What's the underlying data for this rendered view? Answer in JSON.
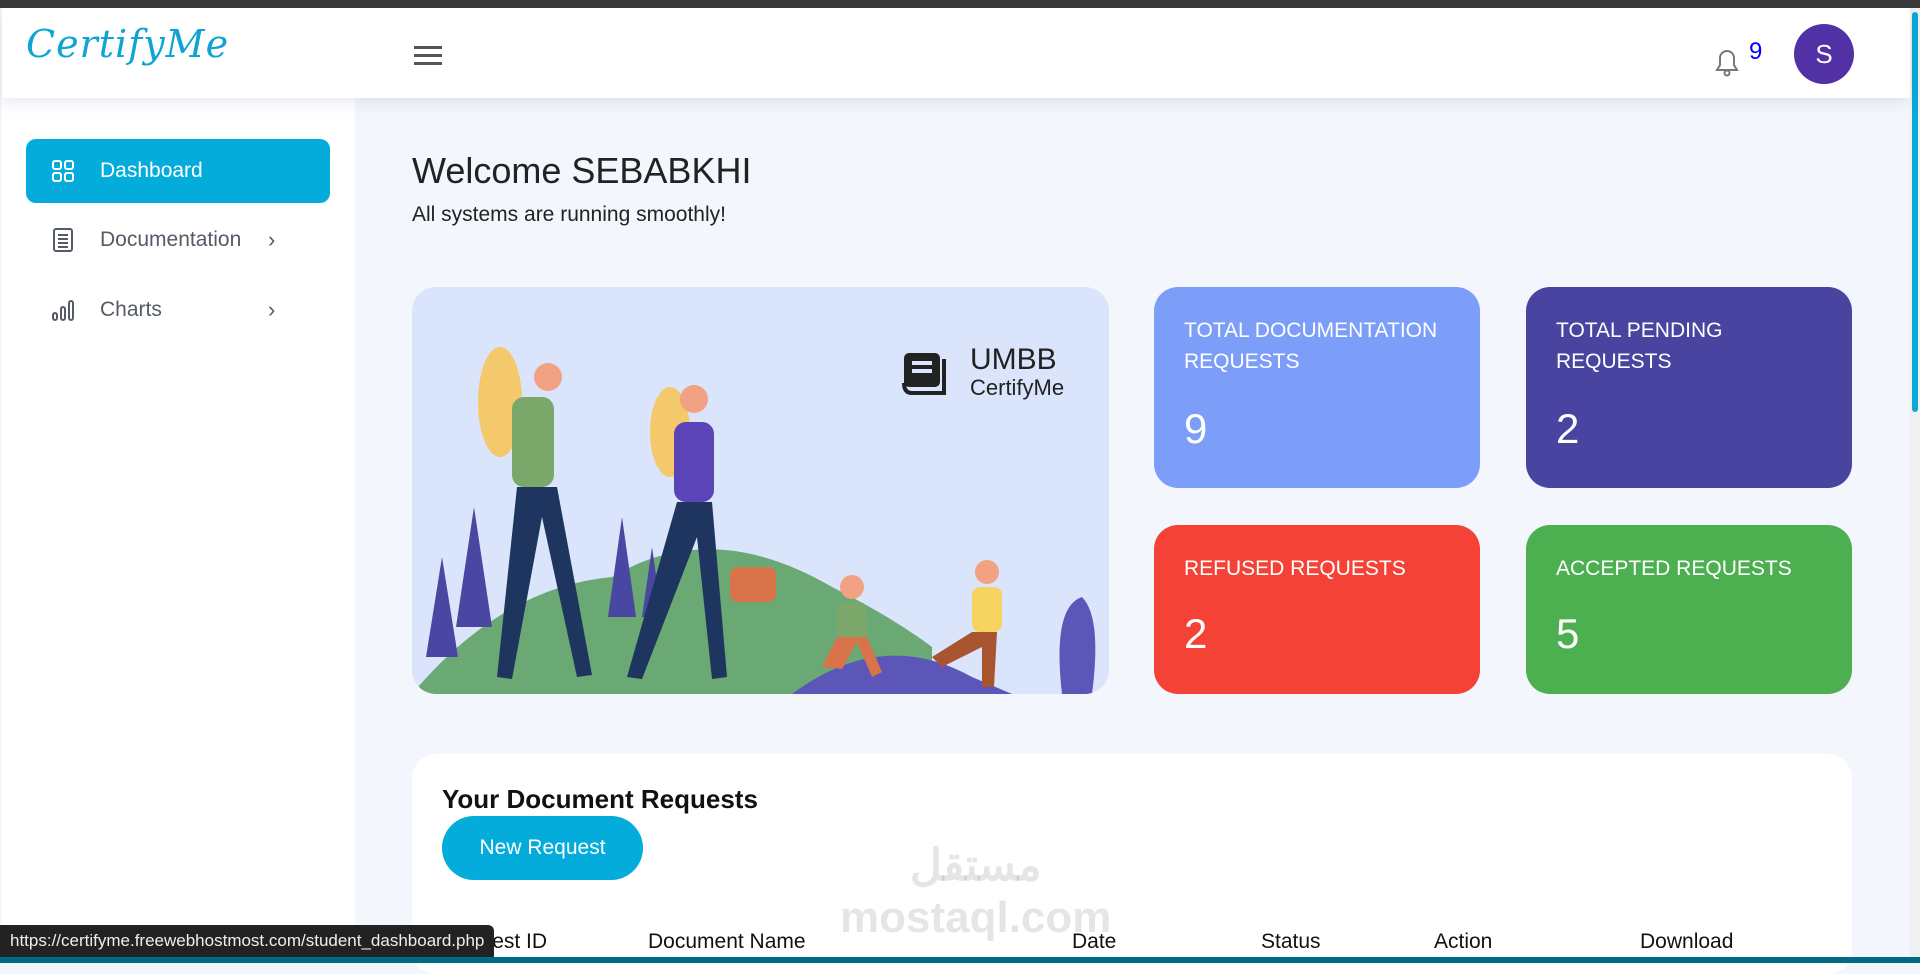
{
  "header": {
    "logo": "CertifyMe",
    "notification_count": "9",
    "avatar_initial": "S"
  },
  "sidebar": {
    "items": [
      {
        "label": "Dashboard",
        "icon": "grid-icon"
      },
      {
        "label": "Documentation",
        "icon": "document-icon"
      },
      {
        "label": "Charts",
        "icon": "bar-chart-icon"
      }
    ]
  },
  "main": {
    "title": "Welcome SEBABKHI",
    "subtitle": "All systems are running smoothly!",
    "banner": {
      "brand_title": "UMBB",
      "brand_sub": "CertifyMe"
    },
    "cards": [
      {
        "label": "TOTAL DOCUMENTATION REQUESTS",
        "value": "9",
        "color": "#7c9ef8"
      },
      {
        "label": "TOTAL PENDING REQUESTS",
        "value": "2",
        "color": "#48449f"
      },
      {
        "label": "REFUSED REQUESTS",
        "value": "2",
        "color": "#f44336"
      },
      {
        "label": "ACCEPTED REQUESTS",
        "value": "5",
        "color": "#4caf50"
      }
    ],
    "requests": {
      "title": "Your Document Requests",
      "new_button": "New Request",
      "columns": [
        "Request ID",
        "Document Name",
        "Date",
        "Status",
        "Action",
        "Download"
      ]
    }
  },
  "watermark": {
    "arabic": "مستقل",
    "latin": "mostaql.com"
  },
  "status_url": "https://certifyme.freewebhostmost.com/student_dashboard.php"
}
